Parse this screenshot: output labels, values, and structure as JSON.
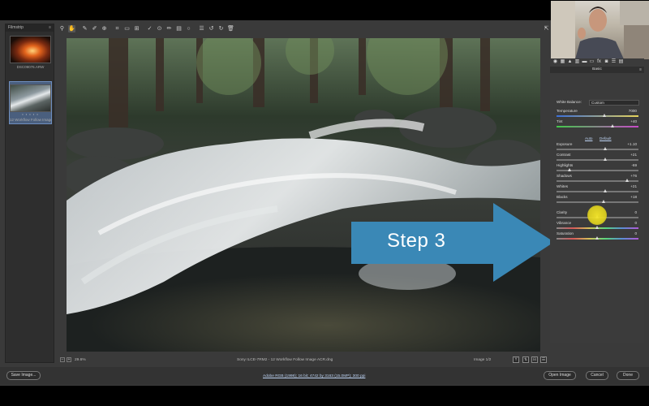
{
  "filmstrip": {
    "title": "Filmstrip",
    "items": [
      {
        "caption": "DSC09076.ARW",
        "selected": false
      },
      {
        "caption": "12 Workflow Follow Image ACR.dng",
        "selected": true,
        "stars": "• • • • •"
      }
    ]
  },
  "toolbar": {
    "tools": [
      "zoom-icon",
      "hand-icon",
      "white-balance-icon",
      "color-sampler-icon",
      "targeted-adjust-icon",
      "crop-icon",
      "straighten-icon",
      "transform-icon",
      "spot-removal-icon",
      "red-eye-icon",
      "adjustment-brush-icon",
      "graduated-filter-icon",
      "radial-filter-icon",
      "preferences-icon",
      "rotate-ccw-icon",
      "rotate-cw-icon",
      "trash-icon"
    ]
  },
  "overlay": {
    "label": "Step 3",
    "color": "#3a88b6"
  },
  "status": {
    "zoom": "29.6%",
    "filename": "Sony ILCE-7RM2  -  12 Workflow Follow Image ACR.dng",
    "image_index": "Image 1/2"
  },
  "panel": {
    "section_title": "Basic",
    "white_balance": {
      "label": "White Balance:",
      "value": "Custom"
    },
    "auto_label": "Auto",
    "default_label": "Default",
    "sliders": [
      {
        "name": "temperature",
        "label": "Temperature",
        "value": "7000",
        "pos": 0.59,
        "track": "temp"
      },
      {
        "name": "tint",
        "label": "Tint",
        "value": "+40",
        "pos": 0.69,
        "track": "tint"
      },
      {
        "name": "exposure",
        "label": "Exposure",
        "value": "+1.10",
        "pos": 0.6,
        "track": ""
      },
      {
        "name": "contrast",
        "label": "Contrast",
        "value": "+21",
        "pos": 0.6,
        "track": ""
      },
      {
        "name": "highlights",
        "label": "Highlights",
        "value": "-69",
        "pos": 0.16,
        "track": ""
      },
      {
        "name": "shadows",
        "label": "Shadows",
        "value": "+76",
        "pos": 0.87,
        "track": ""
      },
      {
        "name": "whites",
        "label": "Whites",
        "value": "+21",
        "pos": 0.6,
        "track": ""
      },
      {
        "name": "blacks",
        "label": "Blacks",
        "value": "+18",
        "pos": 0.58,
        "track": ""
      },
      {
        "name": "clarity",
        "label": "Clarity",
        "value": "0",
        "pos": 0.5,
        "track": ""
      },
      {
        "name": "vibrance",
        "label": "Vibrance",
        "value": "0",
        "pos": 0.5,
        "track": "vib"
      },
      {
        "name": "saturation",
        "label": "Saturation",
        "value": "0",
        "pos": 0.5,
        "track": "vib"
      }
    ]
  },
  "bottom": {
    "save_label": "Save Image...",
    "workflow_link": "Adobe RGB (1998); 16 bit; 4742 by 3163 (15.0MP); 300 ppi",
    "open_label": "Open Image",
    "cancel_label": "Cancel",
    "done_label": "Done"
  }
}
